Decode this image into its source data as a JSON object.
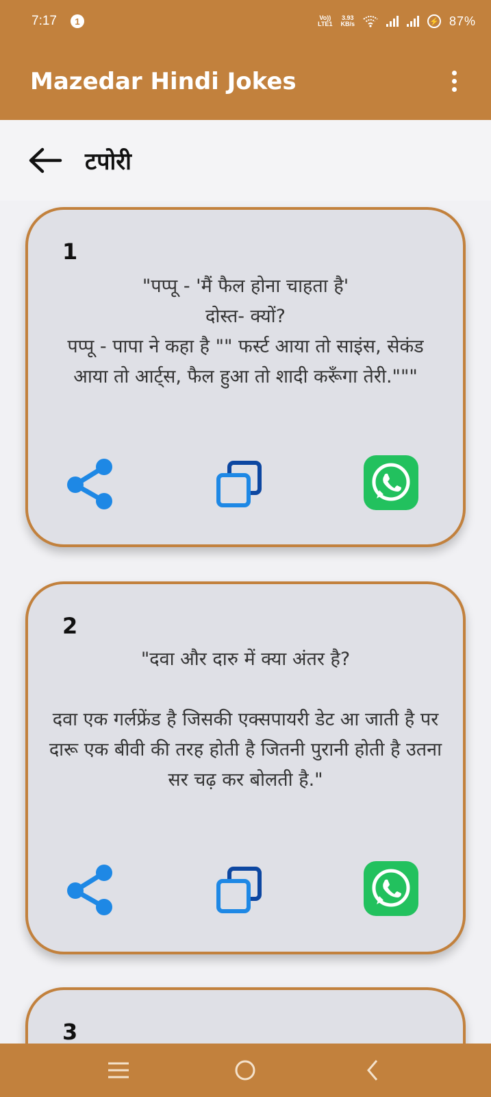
{
  "status_bar": {
    "time": "7:17",
    "notification_count": "1",
    "volte_top": "Vo))",
    "volte_bottom": "LTE1",
    "speed_value": "3.93",
    "speed_unit": "KB/s",
    "battery_percent": "87%"
  },
  "app_bar": {
    "title": "Mazedar Hindi Jokes",
    "menu_icon": "more-vert-icon"
  },
  "sub_header": {
    "back_icon": "arrow-back-icon",
    "title": "टपोरी"
  },
  "jokes": [
    {
      "number": "1",
      "text": "\"पप्पू - 'मैं फैल होना चाहता है'\nदोस्त- क्यों?\nपप्पू - पापा ने कहा है \"\" फर्स्ट आया तो साइंस, सेकंड आया तो आर्ट्स, फैल हुआ तो शादी करूँगा तेरी.\"\"\""
    },
    {
      "number": "2",
      "text": "\"दवा और दारु में क्या अंतर है?\n\nदवा एक गर्लफ्रेंड है जिसकी एक्सपायरी डेट आ जाती है पर दारू एक बीवी की तरह होती है जितनी पुरानी होती है उतना सर चढ़ कर बोलती है.\""
    },
    {
      "number": "3",
      "text": ""
    }
  ],
  "card_actions": {
    "share_icon": "share-icon",
    "copy_icon": "copy-icon",
    "whatsapp_icon": "whatsapp-icon"
  },
  "colors": {
    "brand": "#c2813d",
    "card_bg": "#dfe0e6",
    "whatsapp_green": "#22c15e",
    "share_blue": "#1e88e5"
  },
  "nav_bar": {
    "recents_icon": "menu-lines-icon",
    "home_icon": "home-circle-icon",
    "back_icon": "chevron-left-icon"
  }
}
